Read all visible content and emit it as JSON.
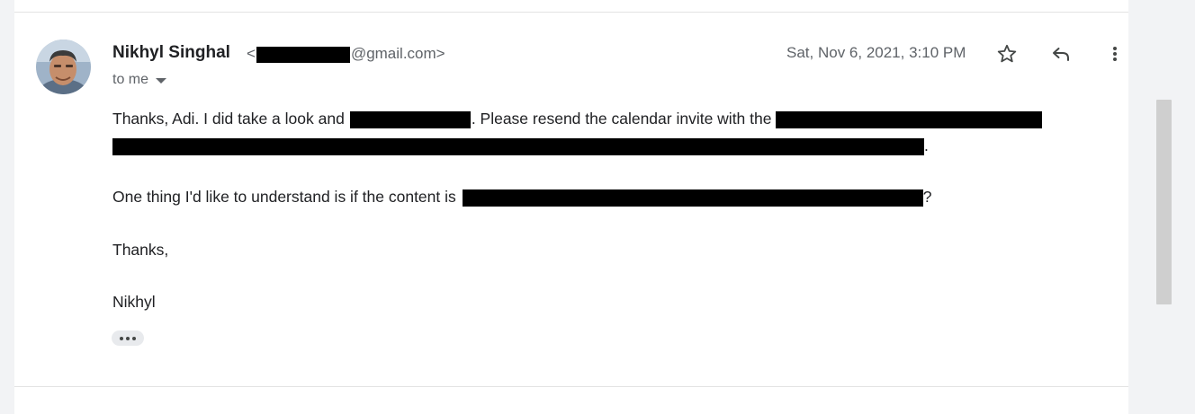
{
  "message": {
    "sender_name": "Nikhyl Singhal",
    "sender_email_prefix": "<",
    "sender_email_suffix": "@gmail.com>",
    "recipient_label": "to me",
    "date": "Sat, Nov 6, 2021, 3:10 PM"
  },
  "actions": {
    "star_icon": "star-icon",
    "reply_icon": "reply-icon",
    "more_icon": "more-vert-icon"
  },
  "body": {
    "line1_part1": "Thanks, Adi.  I did take a look and",
    "line1_part2": ".  Please resend the calendar invite with the",
    "line2_end": ".",
    "line3_part1": "One thing I'd like to understand is if the content is",
    "line3_end": "?",
    "closing": "Thanks,",
    "signature": "Nikhyl"
  },
  "trimmed_content_icon": "ellipsis-icon",
  "colors": {
    "text": "#202124",
    "secondary": "#5f6368",
    "redaction": "#000000"
  }
}
